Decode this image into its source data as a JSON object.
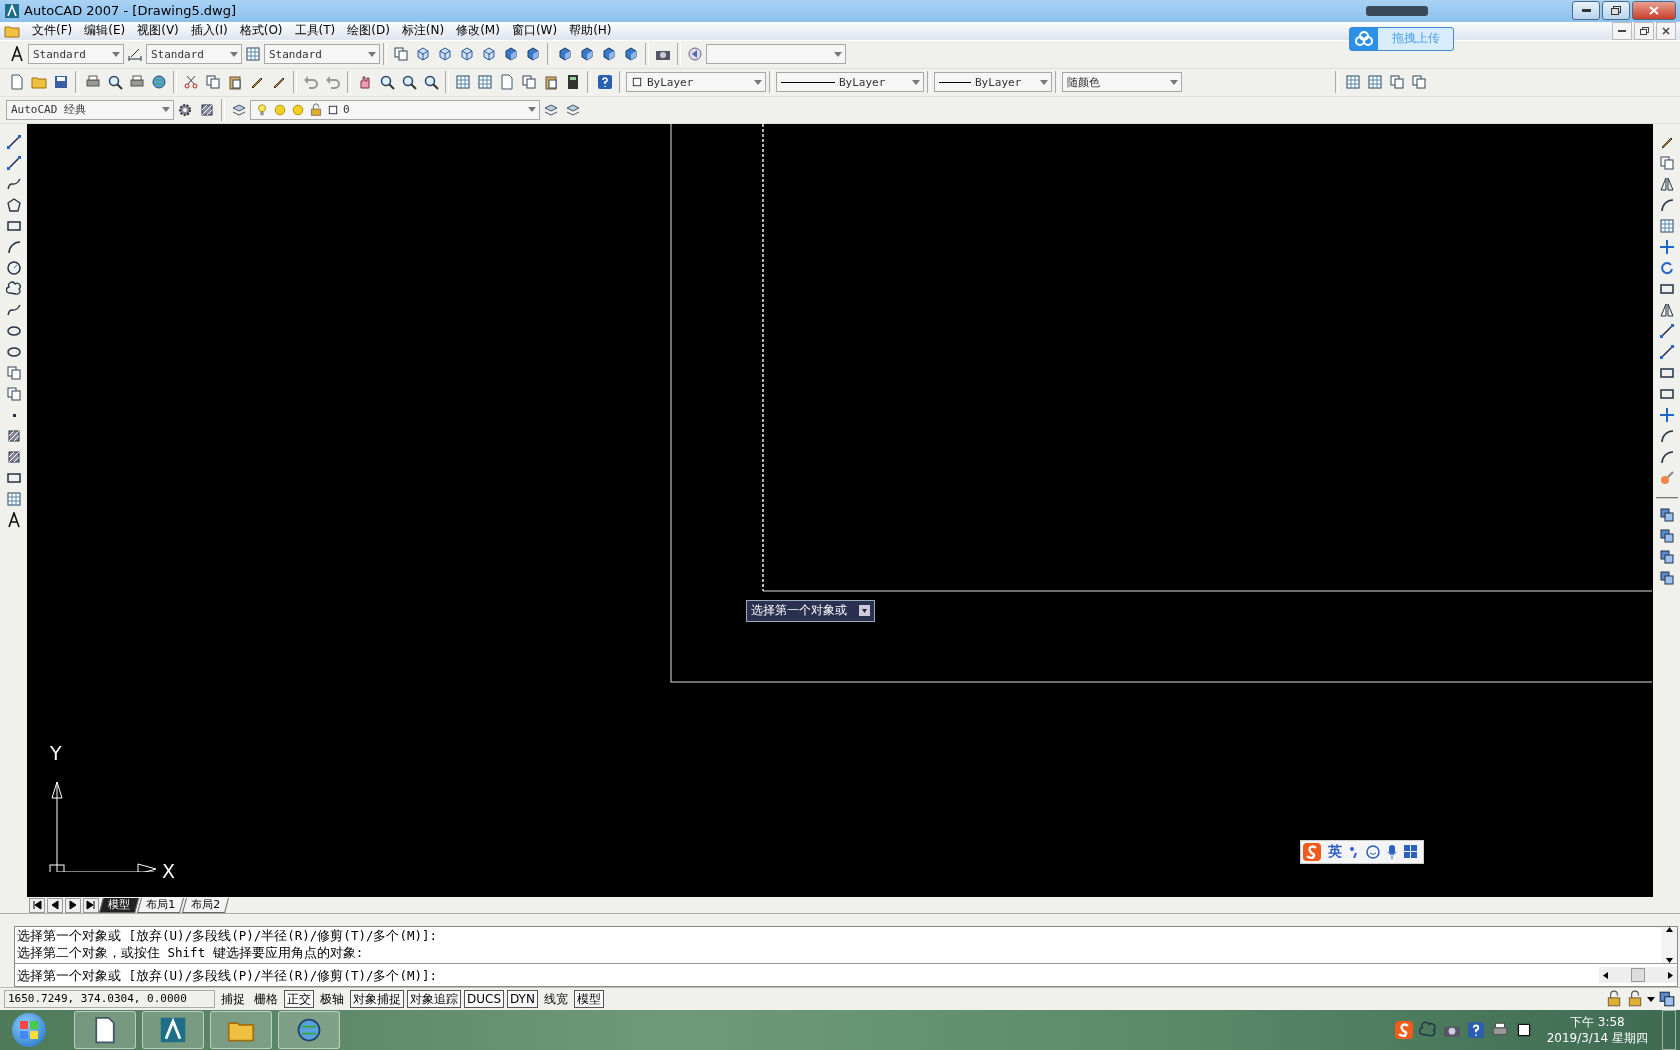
{
  "window": {
    "title": "AutoCAD 2007 - [Drawing5.dwg]"
  },
  "upload_button": {
    "label": "拖拽上传"
  },
  "menu": [
    "文件(F)",
    "编辑(E)",
    "视图(V)",
    "插入(I)",
    "格式(O)",
    "工具(T)",
    "绘图(D)",
    "标注(N)",
    "修改(M)",
    "窗口(W)",
    "帮助(H)"
  ],
  "styles": {
    "text_style": "Standard",
    "dim_style": "Standard",
    "table_style": "Standard"
  },
  "workspace": "AutoCAD 经典",
  "layer": {
    "name": "0"
  },
  "properties": {
    "color_setting": "ByLayer",
    "linetype": "ByLayer",
    "lineweight": "ByLayer",
    "plot_style": "随颜色"
  },
  "canvas": {
    "tooltip": "选择第一个对象或",
    "ucs": {
      "x_label": "X",
      "y_label": "Y"
    },
    "ime": {
      "mode": "英"
    }
  },
  "layout_tabs": [
    {
      "label": "模型",
      "selected": true
    },
    {
      "label": "布局1",
      "selected": false
    },
    {
      "label": "布局2",
      "selected": false
    }
  ],
  "command_lines": [
    "选择第一个对象或 [放弃(U)/多段线(P)/半径(R)/修剪(T)/多个(M)]:",
    "选择第二个对象，或按住 Shift 键选择要应用角点的对象:",
    "选择第一个对象或 [放弃(U)/多段线(P)/半径(R)/修剪(T)/多个(M)]:"
  ],
  "status": {
    "coordinates": "1650.7249, 374.0304, 0.0000",
    "toggles": [
      {
        "label": "捕捉",
        "on": false
      },
      {
        "label": "栅格",
        "on": false
      },
      {
        "label": "正交",
        "on": true
      },
      {
        "label": "极轴",
        "on": false
      },
      {
        "label": "对象捕捉",
        "on": true
      },
      {
        "label": "对象追踪",
        "on": true
      },
      {
        "label": "DUCS",
        "on": true
      },
      {
        "label": "DYN",
        "on": true
      },
      {
        "label": "线宽",
        "on": false
      },
      {
        "label": "模型",
        "on": true
      }
    ]
  },
  "taskbar": {
    "time": "下午 3:58",
    "date": "2019/3/14 星期四"
  }
}
